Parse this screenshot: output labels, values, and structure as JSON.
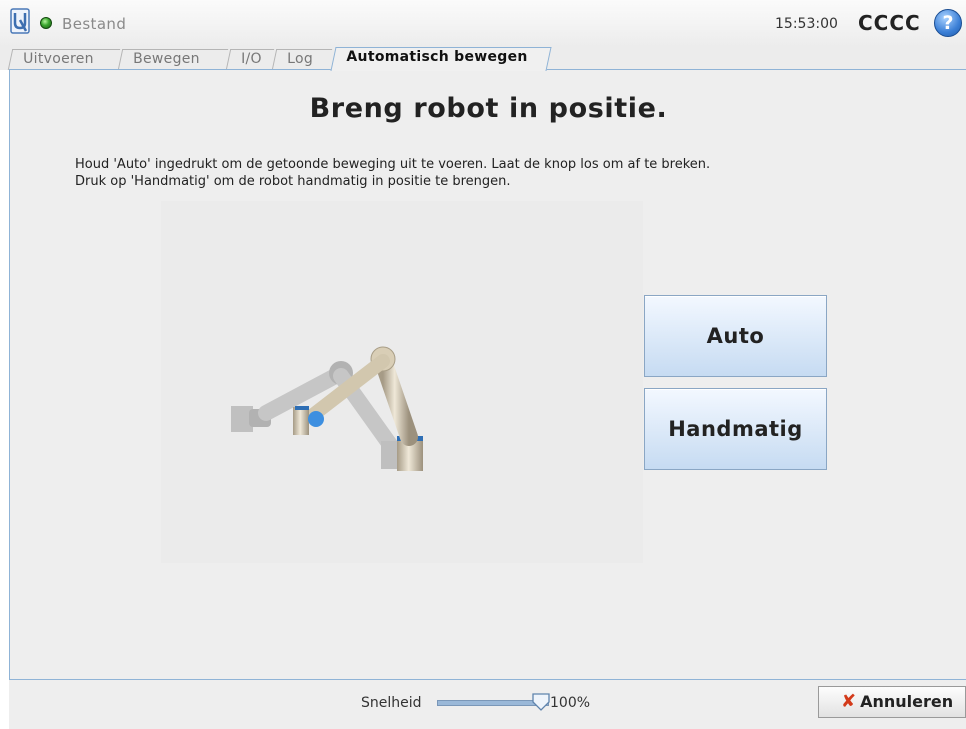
{
  "topbar": {
    "menu_label": "Bestand",
    "time": "15:53:00",
    "robot_name": "CCCC",
    "help_icon": "?",
    "status_color": "#3aa52e"
  },
  "tabs": [
    {
      "label": "Uitvoeren",
      "active": false
    },
    {
      "label": "Bewegen",
      "active": false
    },
    {
      "label": "I/O",
      "active": false
    },
    {
      "label": "Log",
      "active": false
    },
    {
      "label": "Automatisch bewegen",
      "active": true
    }
  ],
  "main": {
    "title": "Breng robot in positie.",
    "instruction_line1": "Houd 'Auto' ingedrukt om de getoonde beweging uit te voeren. Laat de knop los om af te breken.",
    "instruction_line2": "Druk op 'Handmatig' om de robot handmatig in positie te brengen.",
    "auto_button": "Auto",
    "manual_button": "Handmatig"
  },
  "bottombar": {
    "speed_label": "Snelheid",
    "speed_value": "100%",
    "speed_fraction": 1.0,
    "cancel_label": "Annuleren",
    "cancel_icon": "close-x-icon"
  },
  "colors": {
    "accent_border": "#8fb3d6",
    "button_gradient_top": "#f3f8ff",
    "button_gradient_bottom": "#c6dbf2",
    "cancel_icon_color": "#d33a1a",
    "robot_joint": "#3d8fe0"
  }
}
